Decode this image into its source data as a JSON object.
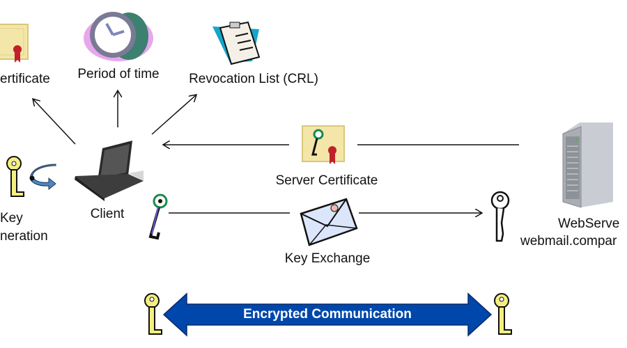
{
  "labels": {
    "certificate": "ertificate",
    "period": "Period of time",
    "crl": "Revocation List (CRL)",
    "server_certificate": "Server Certificate",
    "client": "Client",
    "key_gen_line1": "Key",
    "key_gen_line2": "neration",
    "key_exchange": "Key Exchange",
    "webserver_line1": "WebServe",
    "webserver_line2": "webmail.compar",
    "encrypted": "Encrypted Communication"
  },
  "colors": {
    "banner": "#0047ab",
    "key_yellow": "#f5ef80",
    "certificate": "#f3e6a8",
    "seal": "#c0202a"
  }
}
